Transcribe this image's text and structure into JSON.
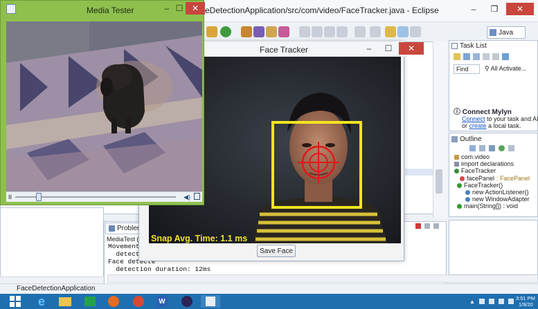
{
  "eclipse": {
    "title": "eDetectionApplication/src/com/video/FaceTracker.java - Eclipse",
    "perspective": "Java",
    "status_project": "FaceDetectionApplication"
  },
  "task_list": {
    "title": "Task List",
    "find_placeholder": "Find",
    "all_label": "All",
    "activate_label": "Activate...",
    "mylyn_title": "Connect Mylyn",
    "mylyn_line1_link": "Connect",
    "mylyn_line1_rest": " to your task and ALM tools",
    "mylyn_line2_pre": "or ",
    "mylyn_line2_link": "create",
    "mylyn_line2_rest": " a local task."
  },
  "outline": {
    "title": "Outline",
    "items": [
      {
        "label": "com.video",
        "suffix": ""
      },
      {
        "label": "import declarations",
        "suffix": ""
      },
      {
        "label": "FaceTracker",
        "suffix": ""
      },
      {
        "label": "facePanel",
        "suffix": " : FacePanel"
      },
      {
        "label": "FaceTracker()",
        "suffix": ""
      },
      {
        "label": "new ActionListener()",
        "suffix": ""
      },
      {
        "label": "new WindowAdapter",
        "suffix": ""
      },
      {
        "label": "main(String[]) : void",
        "suffix": ""
      }
    ]
  },
  "bottom": {
    "problems_tab": "Problems",
    "console_header": "MediaTest (1) [Jav",
    "console_lines": [
      "Movement (x,",
      "  detection c",
      "Face detecte",
      "  detection duration: 12ms"
    ]
  },
  "face_tracker": {
    "title": "Face Tracker",
    "snap_text": "Snap Avg. Time:  1.1 ms",
    "save_button": "Save Face"
  },
  "media_tester": {
    "title": "Media Tester"
  },
  "taskbar": {
    "clock_time": "3:51 PM",
    "clock_date": "1/9/20"
  },
  "colors": {
    "face_box": "#f3e41f",
    "crosshair": "#e01818",
    "media_tester_frame": "#8fc04e",
    "taskbar": "#1f6fb0"
  }
}
